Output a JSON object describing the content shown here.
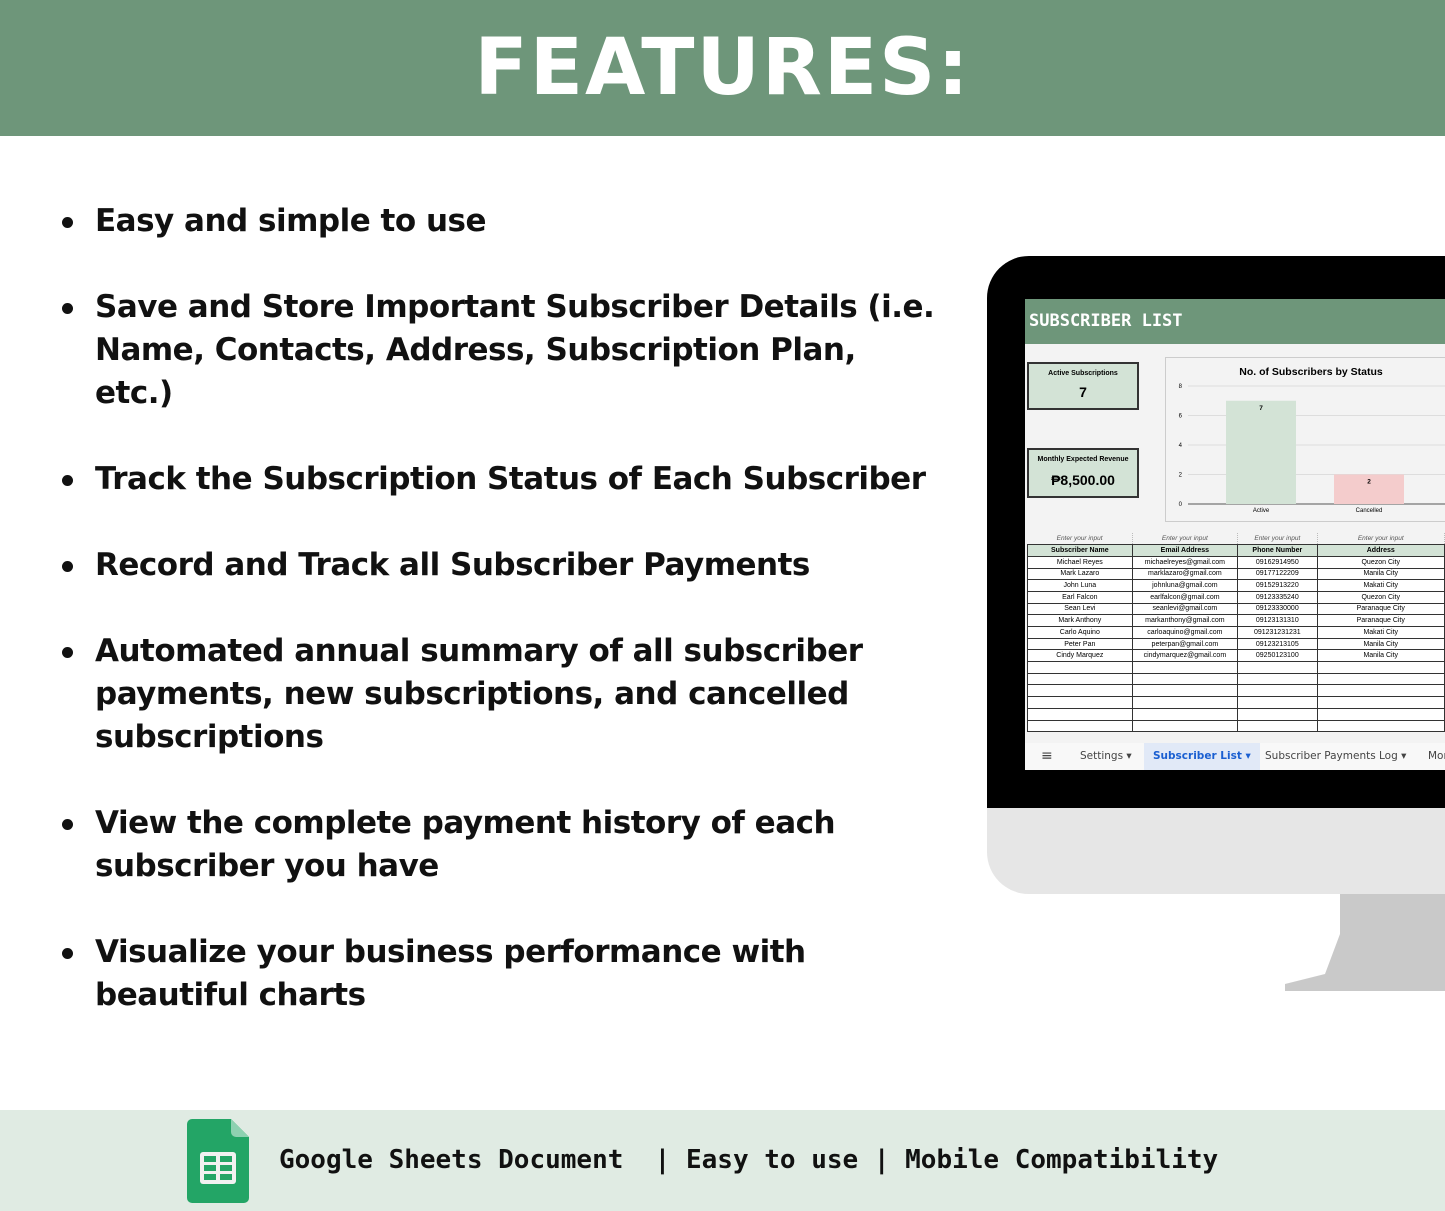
{
  "header": {
    "title": "FEATURES:"
  },
  "features": [
    "Easy and simple to use",
    "Save and Store Important Subscriber Details (i.e. Name, Contacts, Address, Subscription Plan, etc.)",
    "Track the Subscription Status of Each Subscriber",
    "Record and Track all Subscriber Payments",
    "Automated annual summary of all subscriber payments, new subscriptions, and cancelled subscriptions",
    "View the complete payment history of each subscriber you have",
    "Visualize your business performance with beautiful charts"
  ],
  "sheet": {
    "title": "SUBSCRIBER LIST",
    "cards": [
      {
        "label": "Active Subscriptions",
        "value": "7"
      },
      {
        "label": "Monthly Expected Revenue",
        "value": "₱8,500.00"
      }
    ],
    "hint": "Enter your input",
    "columns": [
      "Subscriber Name",
      "Email Address",
      "Phone Number",
      "Address"
    ],
    "rows": [
      [
        "Michael Reyes",
        "michaelreyes@gmail.com",
        "09162914950",
        "Quezon City"
      ],
      [
        "Mark Lazaro",
        "marklazaro@gmail.com",
        "09177122209",
        "Manila City"
      ],
      [
        "John Luna",
        "johnluna@gmail.com",
        "09152913220",
        "Makati City"
      ],
      [
        "Earl Falcon",
        "earlfalcon@gmail.com",
        "09123335240",
        "Quezon City"
      ],
      [
        "Sean Levi",
        "seanlevi@gmail.com",
        "09123330000",
        "Paranaque City"
      ],
      [
        "Mark Anthony",
        "markanthony@gmail.com",
        "09123131310",
        "Paranaque City"
      ],
      [
        "Carlo Aquino",
        "carloaquino@gmail.com",
        "091231231231",
        "Makati City"
      ],
      [
        "Peter Pan",
        "peterpan@gmail.com",
        "09123213105",
        "Manila City"
      ],
      [
        "Cindy Marquez",
        "cindymarquez@gmail.com",
        "09250123100",
        "Manila City"
      ]
    ],
    "tabs": [
      {
        "label": "Settings ▾",
        "active": false
      },
      {
        "label": "Subscriber List ▾",
        "active": true
      },
      {
        "label": "Subscriber Payments Log ▾",
        "active": false
      },
      {
        "label": "Mor",
        "active": false
      }
    ],
    "menu_icon": "hamburger-icon"
  },
  "chart_data": {
    "type": "bar",
    "title": "No. of Subscribers by Status",
    "categories": [
      "Active",
      "Cancelled"
    ],
    "values": [
      7,
      2
    ],
    "colors": [
      "#d3e3d6",
      "#f4cccc"
    ],
    "ylim": [
      0,
      8
    ],
    "yticks": [
      0,
      2,
      4,
      6,
      8
    ],
    "grid": true
  },
  "footer": {
    "icon": "google-sheets-icon",
    "text": "Google Sheets Document  | Easy to use | Mobile Compatibility"
  },
  "colors": {
    "brand": "#6e967a",
    "footer_bg": "#e0ebe3"
  }
}
